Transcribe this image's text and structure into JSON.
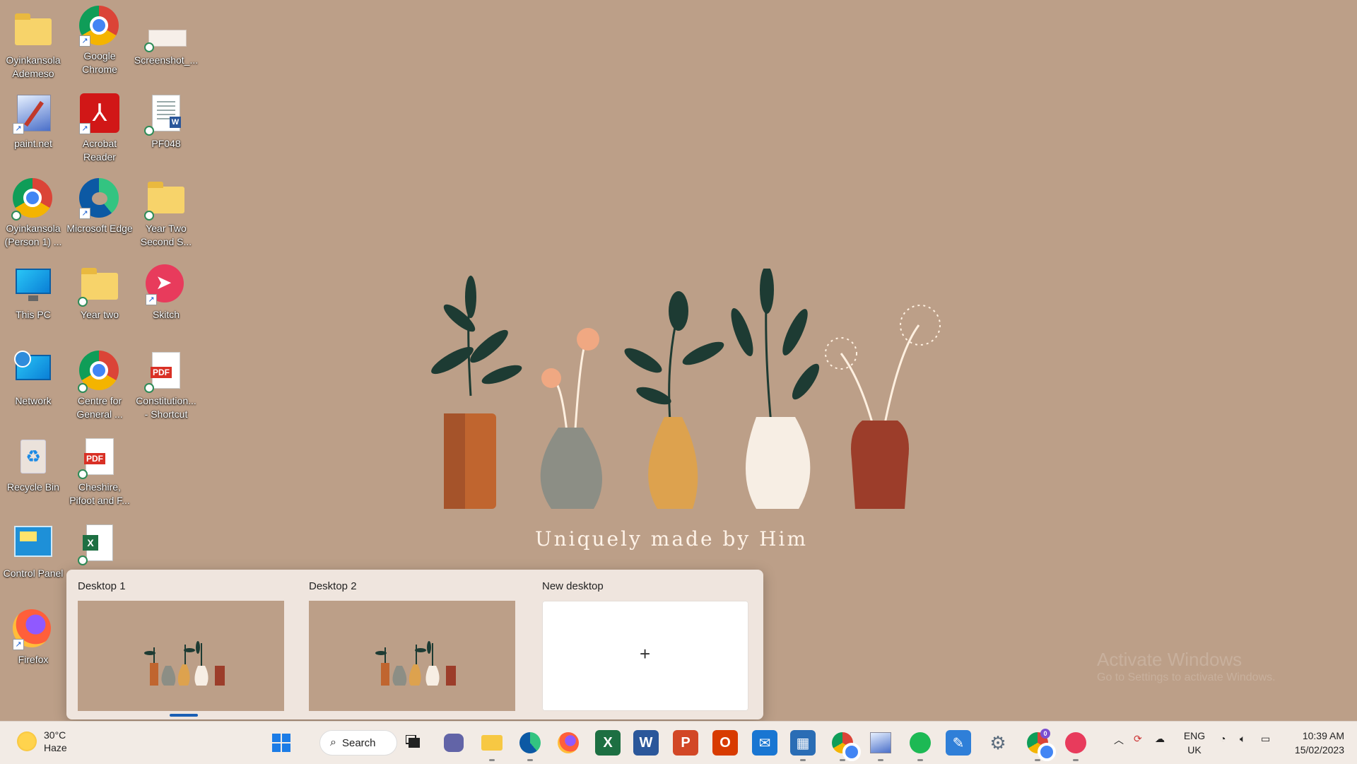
{
  "desktop_icons": [
    {
      "label": "Oyinkansola Ademeso",
      "icon": "user-folder-icon"
    },
    {
      "label": "Google Chrome",
      "icon": "chrome-icon"
    },
    {
      "label": "Screenshot_...",
      "icon": "screenshot-file-icon"
    },
    {
      "label": "paint.net",
      "icon": "paintnet-icon"
    },
    {
      "label": "Acrobat Reader",
      "icon": "acrobat-icon"
    },
    {
      "label": "PF048",
      "icon": "word-document-icon"
    },
    {
      "label": "Oyinkansola (Person 1) ...",
      "icon": "chrome-profile-icon"
    },
    {
      "label": "Microsoft Edge",
      "icon": "edge-icon"
    },
    {
      "label": "Year Two Second S...",
      "icon": "folder-icon"
    },
    {
      "label": "This PC",
      "icon": "this-pc-icon"
    },
    {
      "label": "Year two",
      "icon": "folder-icon"
    },
    {
      "label": "Skitch",
      "icon": "skitch-icon"
    },
    {
      "label": "Network",
      "icon": "network-icon"
    },
    {
      "label": "Centre for General ...",
      "icon": "chrome-icon"
    },
    {
      "label": "Constitution... - Shortcut",
      "icon": "pdf-icon"
    },
    {
      "label": "Recycle Bin",
      "icon": "recycle-bin-icon"
    },
    {
      "label": "Cheshire, Pifoot and F...",
      "icon": "pdf-icon"
    },
    {
      "label": "Control Panel",
      "icon": "control-panel-icon"
    },
    {
      "label": "",
      "icon": "excel-file-icon"
    },
    {
      "label": "Firefox",
      "icon": "firefox-icon"
    }
  ],
  "wallpaper": {
    "caption": "Uniquely made by Him",
    "watermark_line1": "Activate Windows",
    "watermark_line2": "Go to Settings to activate Windows."
  },
  "task_view": {
    "desktops": [
      {
        "title": "Desktop 1",
        "active": true
      },
      {
        "title": "Desktop 2",
        "active": false
      }
    ],
    "new_desktop_label": "New desktop",
    "new_desktop_symbol": "+"
  },
  "taskbar": {
    "weather_temp": "30°C",
    "weather_desc": "Haze",
    "search_label": "Search",
    "language_line1": "ENG",
    "language_line2": "UK",
    "time": "10:39 AM",
    "date": "15/02/2023",
    "chrome_badge": "",
    "chrome_profile_badge": "0",
    "colors": {
      "accent": "#1a5fb4",
      "excel": "#1d6f42",
      "word": "#2b579a",
      "powerpoint": "#d24726",
      "office": "#d83b01",
      "spotify": "#1db954"
    }
  }
}
